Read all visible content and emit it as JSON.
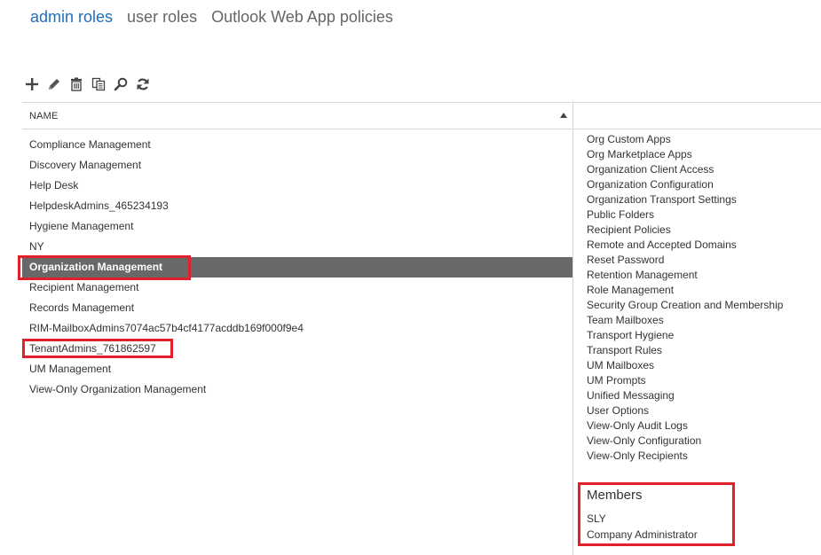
{
  "tabs": [
    {
      "label": "admin roles",
      "active": true
    },
    {
      "label": "user roles",
      "active": false
    },
    {
      "label": "Outlook Web App policies",
      "active": false
    }
  ],
  "toolbar": {
    "icons": [
      "add-icon",
      "edit-icon",
      "delete-icon",
      "copy-icon",
      "search-icon",
      "refresh-icon"
    ]
  },
  "list": {
    "column_header": "NAME",
    "sort": "ascending",
    "rows": [
      "Compliance Management",
      "Discovery Management",
      "Help Desk",
      "HelpdeskAdmins_465234193",
      "Hygiene Management",
      "NY",
      "Organization Management",
      "Recipient Management",
      "Records Management",
      "RIM-MailboxAdmins7074ac57b4cf4177acddb169f000f9e4",
      "TenantAdmins_761862597",
      "UM Management",
      "View-Only Organization Management"
    ],
    "selected_index": 6
  },
  "details": {
    "roles": [
      "Org Custom Apps",
      "Org Marketplace Apps",
      "Organization Client Access",
      "Organization Configuration",
      "Organization Transport Settings",
      "Public Folders",
      "Recipient Policies",
      "Remote and Accepted Domains",
      "Reset Password",
      "Retention Management",
      "Role Management",
      "Security Group Creation and Membership",
      "Team Mailboxes",
      "Transport Hygiene",
      "Transport Rules",
      "UM Mailboxes",
      "UM Prompts",
      "Unified Messaging",
      "User Options",
      "View-Only Audit Logs",
      "View-Only Configuration",
      "View-Only Recipients"
    ],
    "members_title": "Members",
    "members": [
      "SLY",
      "Company Administrator"
    ]
  },
  "colors": {
    "accent": "#1e6ec0",
    "selected_row": "#686868",
    "highlight": "#e0202a"
  }
}
